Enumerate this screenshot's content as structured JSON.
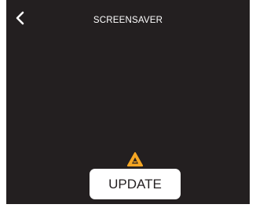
{
  "header": {
    "title": "SCREENSAVER",
    "back_icon": "chevron-left-icon"
  },
  "footer": {
    "update_label": "UPDATE",
    "update_icon": "warning-triangle-icon",
    "update_icon_color": "#f5a623"
  },
  "colors": {
    "background": "#231f20",
    "text": "#ffffff",
    "button": "#ffffff",
    "button_text": "#231f20"
  }
}
